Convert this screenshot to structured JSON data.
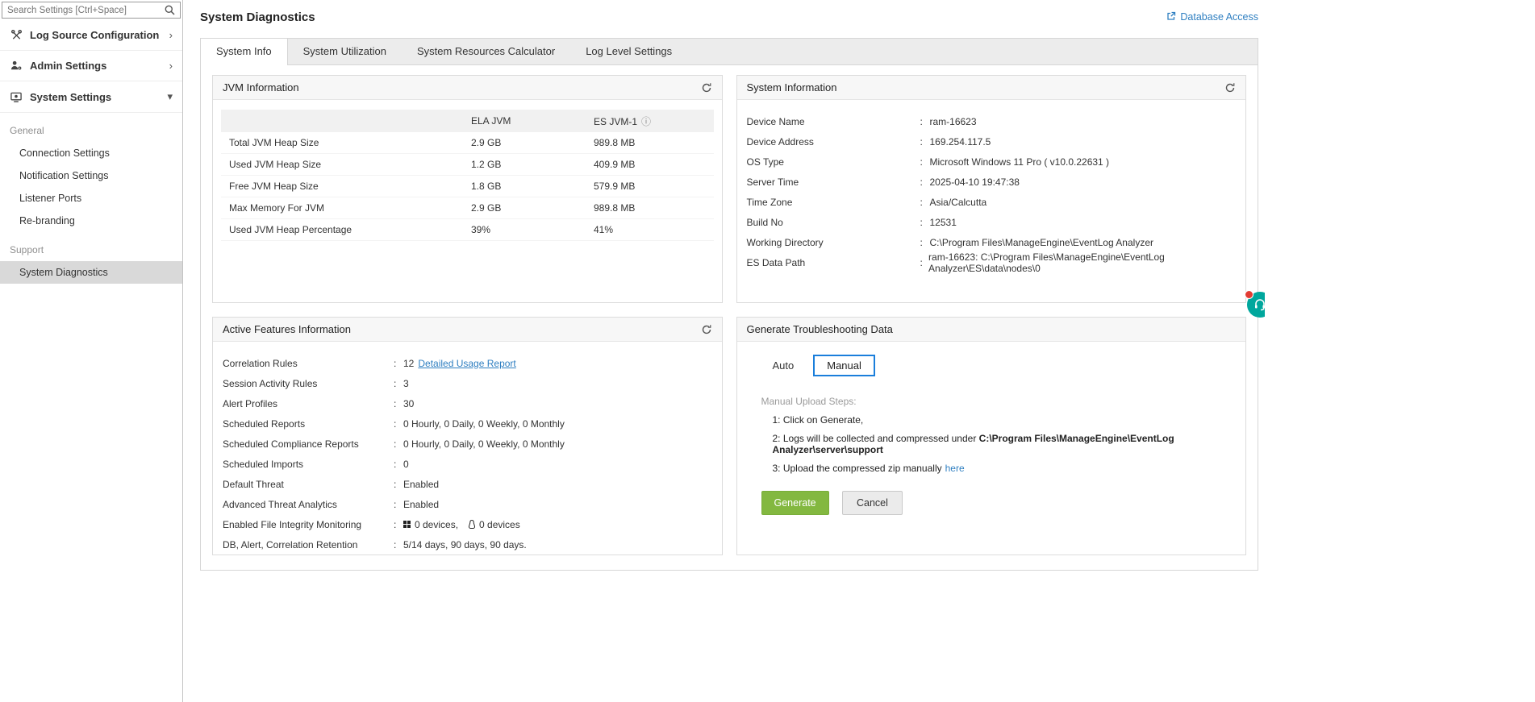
{
  "ui": {
    "colon": ":"
  },
  "icons": {
    "chevron_right": "›",
    "chevron_down": "▾",
    "info": "ⓘ"
  },
  "colors": {
    "accent_green": "#83b840",
    "link_blue": "#2f7fc1",
    "manual_selected_border": "#1a7edb",
    "chat_teal": "#00a79d",
    "badge_red": "#e23c33",
    "selected_item_bg": "#d9d9d9"
  },
  "sidebar": {
    "search": {
      "placeholder": "Search Settings [Ctrl+Space]"
    },
    "nav": [
      {
        "label": "Log Source Configuration"
      },
      {
        "label": "Admin Settings"
      },
      {
        "label": "System Settings"
      }
    ],
    "sections": [
      {
        "title": "General"
      },
      {
        "title": "Support"
      }
    ],
    "general_items": [
      "Connection Settings",
      "Notification Settings",
      "Listener Ports",
      "Re-branding"
    ],
    "support_items": [
      "System Diagnostics"
    ]
  },
  "header": {
    "title": "System Diagnostics",
    "database_access": "Database Access"
  },
  "tabs": {
    "active": "System Info",
    "items": [
      "System Info",
      "System Utilization",
      "System Resources Calculator",
      "Log Level Settings"
    ]
  },
  "jvm": {
    "title": "JVM Information",
    "col_ela": "ELA JVM",
    "col_es": "ES JVM-1",
    "rows": [
      {
        "label": "Total JVM Heap Size",
        "ela": "2.9 GB",
        "es": "989.8 MB"
      },
      {
        "label": "Used JVM Heap Size",
        "ela": "1.2 GB",
        "es": "409.9 MB"
      },
      {
        "label": "Free JVM Heap Size",
        "ela": "1.8 GB",
        "es": "579.9 MB"
      },
      {
        "label": "Max Memory For JVM",
        "ela": "2.9 GB",
        "es": "989.8 MB"
      },
      {
        "label": "Used JVM Heap Percentage",
        "ela": "39%",
        "es": "41%"
      }
    ]
  },
  "system": {
    "title": "System Information",
    "rows": [
      {
        "label": "Device Name",
        "value": "ram-16623"
      },
      {
        "label": "Device Address",
        "value": "169.254.117.5"
      },
      {
        "label": "OS Type",
        "value": "Microsoft Windows 11 Pro ( v10.0.22631 )"
      },
      {
        "label": "Server Time",
        "value": "2025-04-10 19:47:38"
      },
      {
        "label": "Time Zone",
        "value": "Asia/Calcutta"
      },
      {
        "label": "Build No",
        "value": "12531"
      },
      {
        "label": "Working Directory",
        "value": "C:\\Program Files\\ManageEngine\\EventLog Analyzer"
      },
      {
        "label": "ES Data Path",
        "value": "ram-16623: C:\\Program Files\\ManageEngine\\EventLog Analyzer\\ES\\data\\nodes\\0"
      }
    ]
  },
  "features": {
    "title": "Active Features Information",
    "rows": [
      {
        "label": "Correlation Rules",
        "value": "12",
        "link": "Detailed Usage Report"
      },
      {
        "label": "Session Activity Rules",
        "value": "3"
      },
      {
        "label": "Alert Profiles",
        "value": "30"
      },
      {
        "label": "Scheduled Reports",
        "value": "0 Hourly, 0 Daily, 0 Weekly, 0 Monthly"
      },
      {
        "label": "Scheduled Compliance Reports",
        "value": "0 Hourly, 0 Daily, 0 Weekly, 0 Monthly"
      },
      {
        "label": "Scheduled Imports",
        "value": "0"
      },
      {
        "label": "Default Threat",
        "value": "Enabled"
      },
      {
        "label": "Advanced Threat Analytics",
        "value": "Enabled"
      },
      {
        "label": "Enabled File Integrity Monitoring",
        "windows": "0 devices,",
        "linux": "0 devices"
      },
      {
        "label": "DB, Alert, Correlation Retention",
        "value": "5/14 days, 90 days, 90 days."
      }
    ]
  },
  "troubleshoot": {
    "title": "Generate Troubleshooting Data",
    "auto_label": "Auto",
    "manual_label": "Manual",
    "steps_title": "Manual Upload Steps:",
    "step1": "1: Click on Generate,",
    "step2_prefix": "2: Logs will be collected and compressed under ",
    "step2_path": "C:\\Program Files\\ManageEngine\\EventLog Analyzer\\server\\support",
    "step3_prefix": "3: Upload the compressed zip manually",
    "step3_link": "here",
    "generate_label": "Generate",
    "cancel_label": "Cancel"
  }
}
